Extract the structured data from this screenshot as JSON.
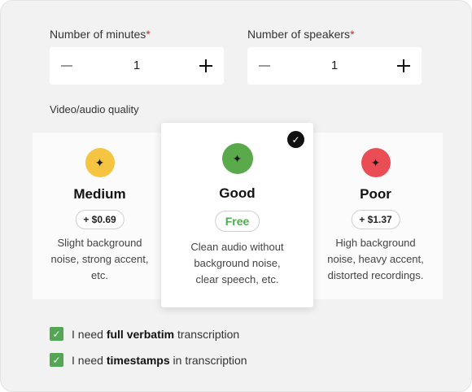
{
  "minutes": {
    "label": "Number of minutes",
    "required_mark": "*",
    "value": "1"
  },
  "speakers": {
    "label": "Number of speakers",
    "required_mark": "*",
    "value": "1"
  },
  "quality": {
    "label": "Video/audio quality",
    "selected": "Good",
    "options": [
      {
        "title": "Medium",
        "price": "+ $0.69",
        "desc_lines": [
          "Slight background",
          "noise, strong accent,",
          "etc."
        ],
        "color": "#f5c542",
        "icon": "sparkle-icon"
      },
      {
        "title": "Good",
        "price": "Free",
        "desc_lines": [
          "Clean audio without",
          "background noise,",
          "clear speech, etc."
        ],
        "color": "#5aaa4c",
        "icon": "sparkle-icon"
      },
      {
        "title": "Poor",
        "price": "+ $1.37",
        "desc_lines": [
          "High background",
          "noise, heavy accent,",
          "distorted recordings."
        ],
        "color": "#eb4d55",
        "icon": "sparkle-icon"
      }
    ]
  },
  "options": [
    {
      "prefix": "I need ",
      "bold": "full verbatim",
      "suffix": " transcription",
      "checked": true
    },
    {
      "prefix": "I need ",
      "bold": "timestamps",
      "suffix": " in transcription",
      "checked": true
    }
  ],
  "colors": {
    "accent_green": "#53a653",
    "required_red": "#d9262c"
  }
}
